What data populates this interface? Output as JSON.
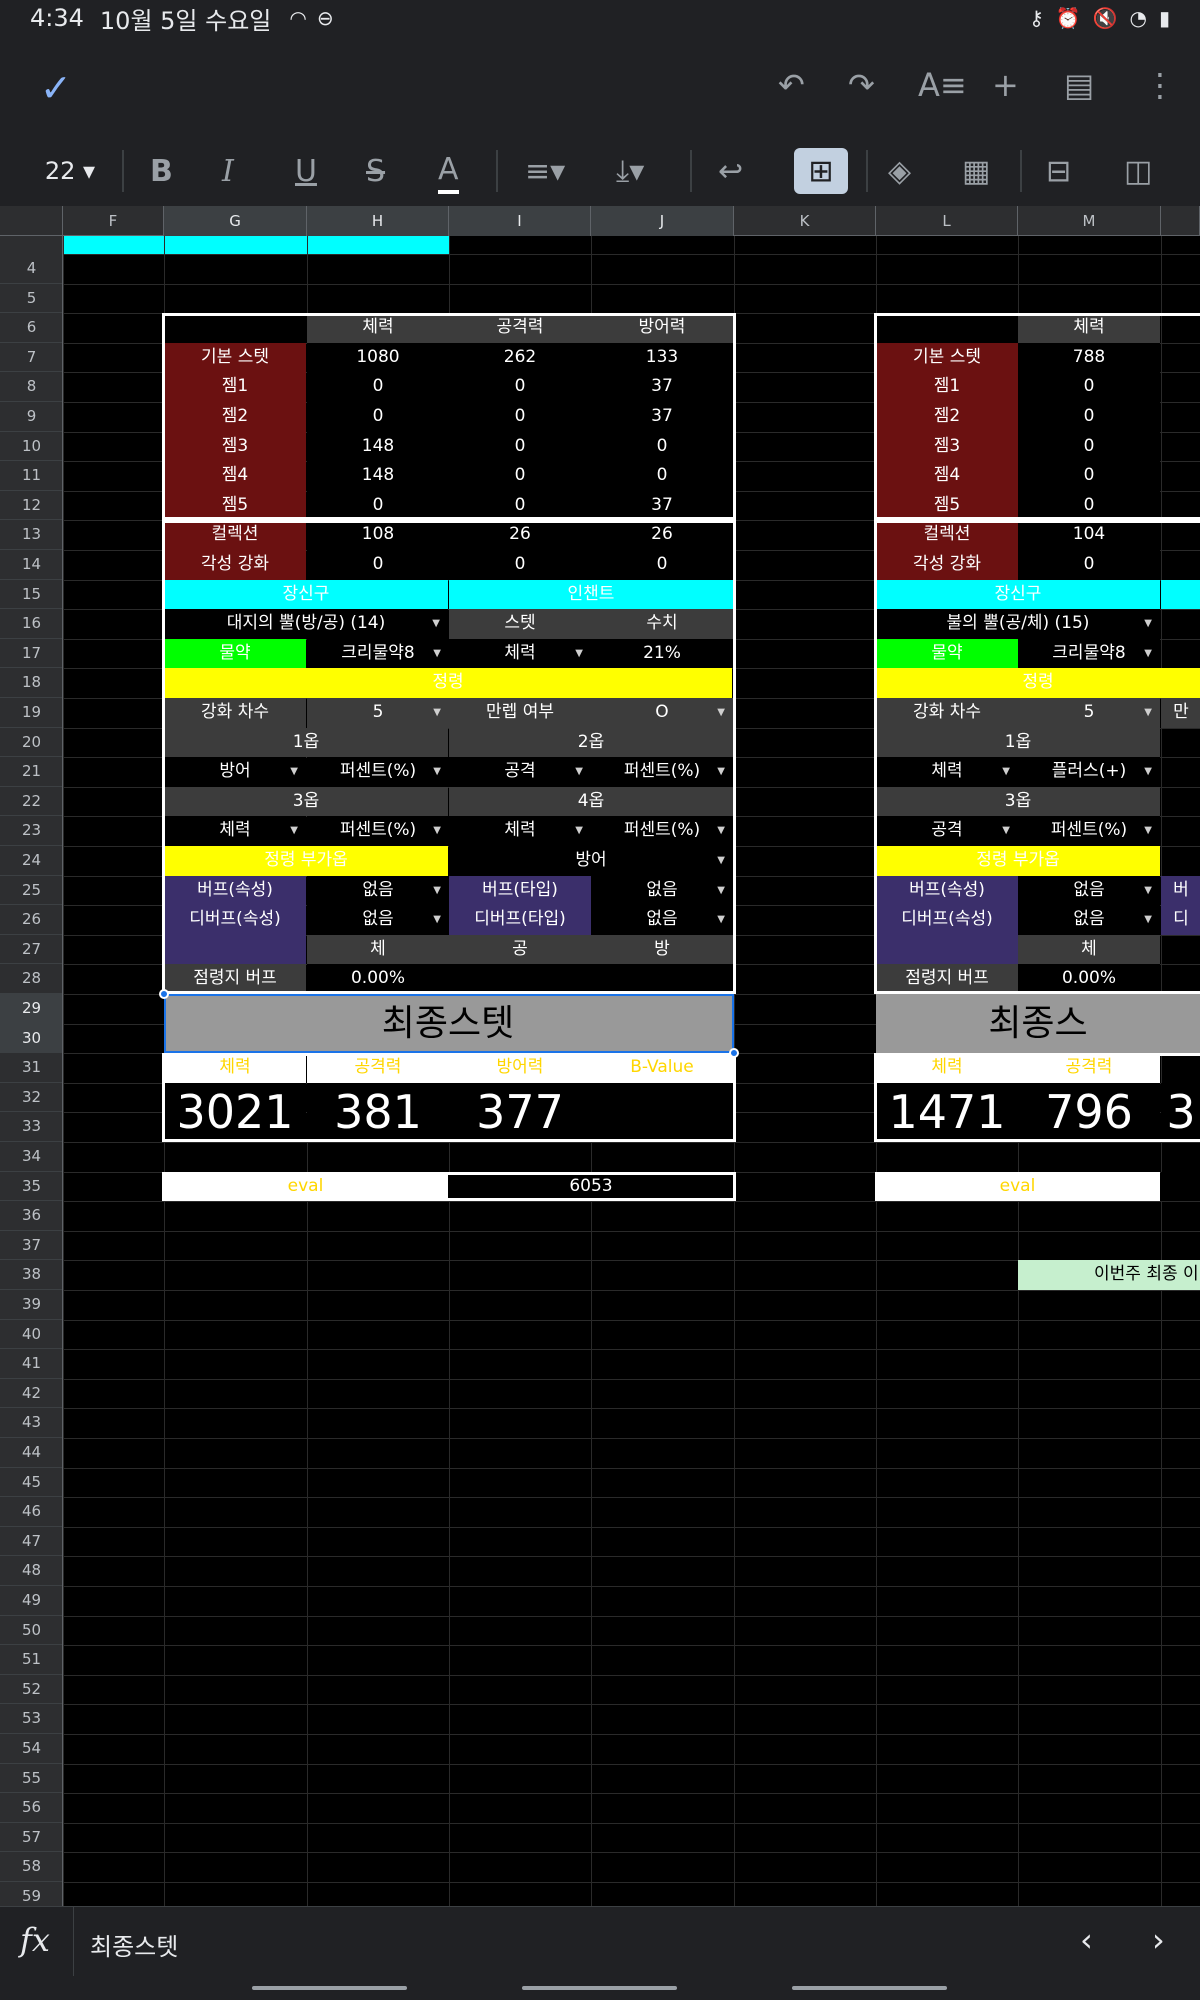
{
  "status": {
    "time": "4:34",
    "date": "10월 5일 수요일"
  },
  "toolbar": {
    "font_size": "22"
  },
  "columns": [
    "F",
    "G",
    "H",
    "I",
    "J",
    "K",
    "L",
    "M"
  ],
  "rows": [
    "4",
    "5",
    "6",
    "7",
    "8",
    "9",
    "10",
    "11",
    "12",
    "13",
    "14",
    "15",
    "16",
    "17",
    "18",
    "19",
    "20",
    "21",
    "22",
    "23",
    "24",
    "25",
    "26",
    "27",
    "28",
    "29",
    "30",
    "31",
    "32",
    "33",
    "34",
    "35",
    "36",
    "37",
    "38",
    "39",
    "40",
    "41",
    "42",
    "43",
    "44",
    "45",
    "46",
    "47",
    "48",
    "49",
    "50",
    "51",
    "52",
    "53",
    "54",
    "55",
    "56",
    "57",
    "58",
    "59"
  ],
  "left": {
    "hdr": [
      "체력",
      "공격력",
      "방어력"
    ],
    "stat_rows": [
      {
        "label": "기본 스텟",
        "v": [
          "1080",
          "262",
          "133"
        ]
      },
      {
        "label": "젬1",
        "v": [
          "0",
          "0",
          "37"
        ]
      },
      {
        "label": "젬2",
        "v": [
          "0",
          "0",
          "37"
        ]
      },
      {
        "label": "젬3",
        "v": [
          "148",
          "0",
          "0"
        ]
      },
      {
        "label": "젬4",
        "v": [
          "148",
          "0",
          "0"
        ]
      },
      {
        "label": "젬5",
        "v": [
          "0",
          "0",
          "37"
        ]
      },
      {
        "label": "컬렉션",
        "v": [
          "108",
          "26",
          "26"
        ]
      },
      {
        "label": "각성 강화",
        "v": [
          "0",
          "0",
          "0"
        ]
      }
    ],
    "r15": [
      "장신구",
      "인챈트"
    ],
    "r16": [
      "대지의 뿔(방/공) (14)",
      "스텟",
      "수치"
    ],
    "r17": [
      "물약",
      "크리물약8",
      "체력",
      "21%"
    ],
    "r18": "정령",
    "r19": [
      "강화 차수",
      "5",
      "만렙 여부",
      "O"
    ],
    "r20": [
      "1옵",
      "2옵"
    ],
    "r21": [
      "방어",
      "퍼센트(%)",
      "공격",
      "퍼센트(%)"
    ],
    "r22": [
      "3옵",
      "4옵"
    ],
    "r23": [
      "체력",
      "퍼센트(%)",
      "체력",
      "퍼센트(%)"
    ],
    "r24": [
      "정령 부가옵",
      "방어"
    ],
    "r25": [
      "버프(속성)",
      "없음",
      "버프(타입)",
      "없음"
    ],
    "r26": [
      "디버프(속성)",
      "없음",
      "디버프(타입)",
      "없음"
    ],
    "r27": [
      "체",
      "공",
      "방"
    ],
    "r28": [
      "점령지 버프",
      "0.00%"
    ],
    "final_title": "최종스텟",
    "final_hdr": [
      "체력",
      "공격력",
      "방어력",
      "B-Value"
    ],
    "final_vals": [
      "3021",
      "381",
      "377",
      ""
    ],
    "eval_label": "eval",
    "eval_value": "6053"
  },
  "right": {
    "hdr": [
      "체력"
    ],
    "stat_rows": [
      {
        "label": "기본 스텟",
        "v": "788"
      },
      {
        "label": "젬1",
        "v": "0"
      },
      {
        "label": "젬2",
        "v": "0"
      },
      {
        "label": "젬3",
        "v": "0"
      },
      {
        "label": "젬4",
        "v": "0"
      },
      {
        "label": "젬5",
        "v": "0"
      },
      {
        "label": "컬렉션",
        "v": "104"
      },
      {
        "label": "각성 강화",
        "v": "0"
      }
    ],
    "r15": "장신구",
    "r16": "불의 뿔(공/체) (15)",
    "r17": [
      "물약",
      "크리물약8"
    ],
    "r18": "정령",
    "r19": [
      "강화 차수",
      "5",
      "만"
    ],
    "r20": "1옵",
    "r21": [
      "체력",
      "플러스(+)"
    ],
    "r22": "3옵",
    "r23": [
      "공격",
      "퍼센트(%)"
    ],
    "r24": "정령 부가옵",
    "r25": [
      "버프(속성)",
      "없음",
      "버"
    ],
    "r26": [
      "디버프(속성)",
      "없음",
      "디"
    ],
    "r27": "체",
    "r28": [
      "점령지 버프",
      "0.00%"
    ],
    "final_title": "최종스",
    "final_hdr": [
      "체력",
      "공격력"
    ],
    "final_vals": [
      "1471",
      "796",
      "3"
    ],
    "eval_label": "eval",
    "note": "이번주 최종 이"
  },
  "formula": {
    "content": "최종스텟"
  },
  "colors": {
    "accent": "#8ab4f8",
    "selection": "#1a73e8",
    "gem_label": "#6b1111",
    "buff_label": "#3b2f6b",
    "cyan": "#00ffff",
    "yellow": "#ffff00",
    "green": "#00ff00"
  }
}
